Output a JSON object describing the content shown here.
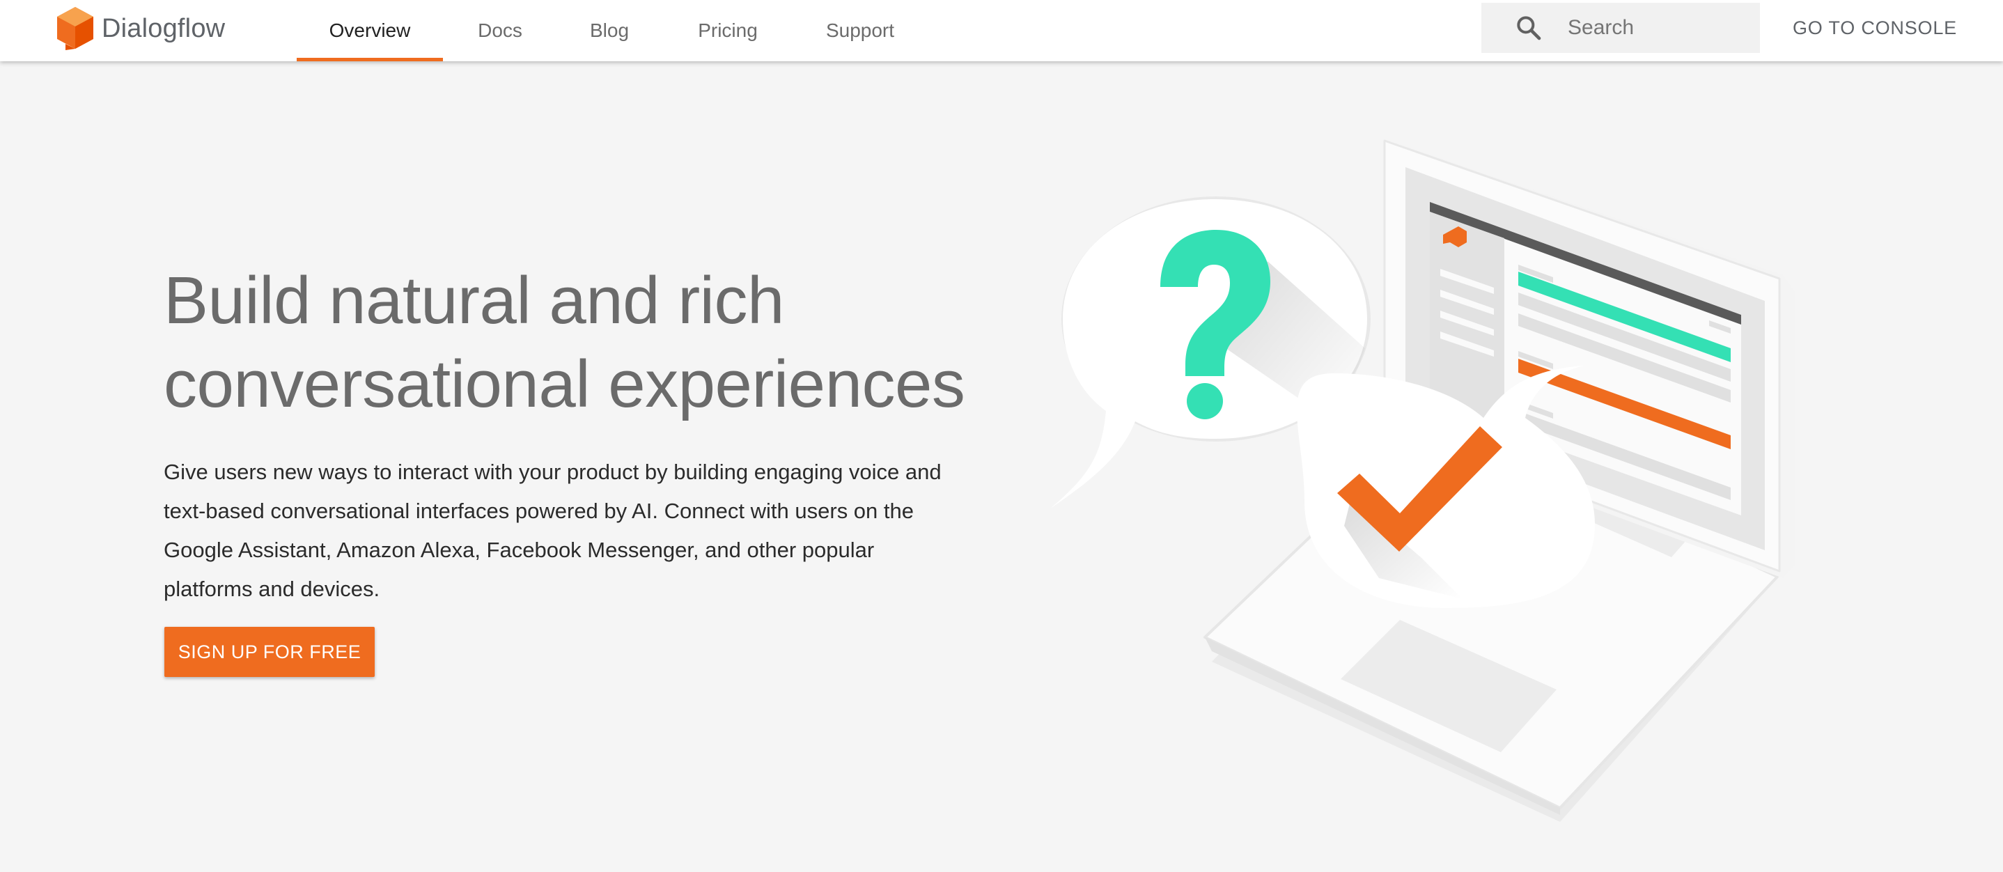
{
  "brand": {
    "name": "Dialogflow",
    "logo_icon": "dialogflow-cube-icon",
    "accent": "#ef6c1f"
  },
  "nav": {
    "items": [
      {
        "label": "Overview",
        "active": true
      },
      {
        "label": "Docs",
        "active": false
      },
      {
        "label": "Blog",
        "active": false
      },
      {
        "label": "Pricing",
        "active": false
      },
      {
        "label": "Support",
        "active": false
      }
    ]
  },
  "search": {
    "icon": "search-icon",
    "placeholder": "Search",
    "value": ""
  },
  "console_link": "GO TO CONSOLE",
  "hero": {
    "title_line1": "Build natural and rich",
    "title_line2": "conversational experiences",
    "description_lines": [
      "Give users new ways to interact with your product by building engaging voice and",
      "text-based conversational interfaces powered by AI. Connect with users on the",
      "Google Assistant, Amazon Alexa, Facebook Messenger, and other popular",
      "platforms and devices."
    ],
    "cta_label": "SIGN UP FOR FREE"
  },
  "illustration": {
    "icons": [
      "laptop-illustration",
      "question-mark-icon",
      "checkmark-icon"
    ],
    "colors": {
      "teal": "#34e0b4",
      "orange": "#ef6c1f"
    }
  }
}
